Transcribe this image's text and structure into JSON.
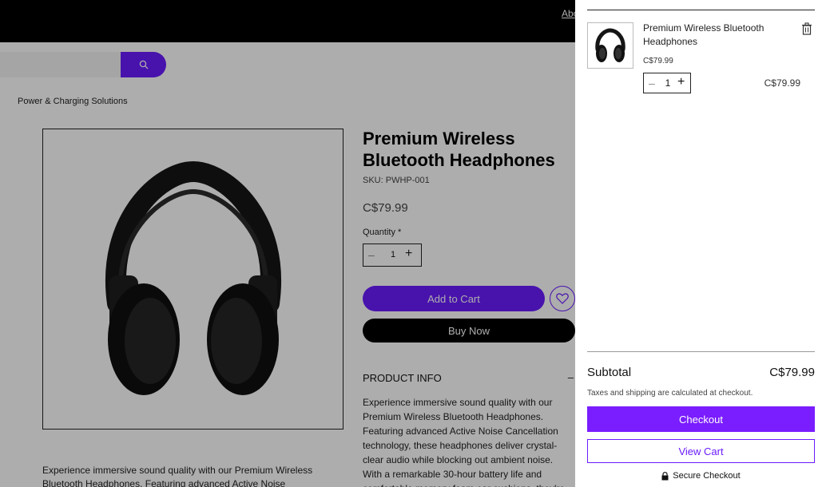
{
  "header": {
    "top_link": "Abo",
    "search_placeholder": ""
  },
  "breadcrumb": "Power & Charging Solutions",
  "product": {
    "title": "Premium Wireless Bluetooth Headphones",
    "sku": "SKU: PWHP-001",
    "price": "C$79.99",
    "quantity_label": "Quantity *",
    "quantity_value": "1",
    "add_to_cart": "Add to Cart",
    "buy_now": "Buy Now",
    "info_heading": "PRODUCT INFO",
    "info_toggle": "–",
    "info_text": "Experience immersive sound quality with our Premium Wireless Bluetooth Headphones. Featuring advanced Active Noise Cancellation technology, these headphones deliver crystal-clear audio while blocking out ambient noise. With a remarkable 30-hour battery life and comfortable memory foam ear cushions, they're perfect for",
    "description": "Experience immersive sound quality with our Premium Wireless Bluetooth Headphones. Featuring advanced Active Noise"
  },
  "cart": {
    "item_name": "Premium Wireless Bluetooth Headphones",
    "item_unit_price": "C$79.99",
    "item_qty": "1",
    "item_total": "C$79.99",
    "subtotal_label": "Subtotal",
    "subtotal_value": "C$79.99",
    "tax_note": "Taxes and shipping are calculated at checkout.",
    "checkout": "Checkout",
    "view_cart": "View Cart",
    "secure": "Secure Checkout"
  },
  "colors": {
    "accent": "#6a1bff",
    "checkout": "#7a1dff"
  },
  "icons": {
    "search": "search-icon",
    "wishlist": "heart-icon",
    "delete": "trash-icon",
    "lock": "lock-icon"
  }
}
